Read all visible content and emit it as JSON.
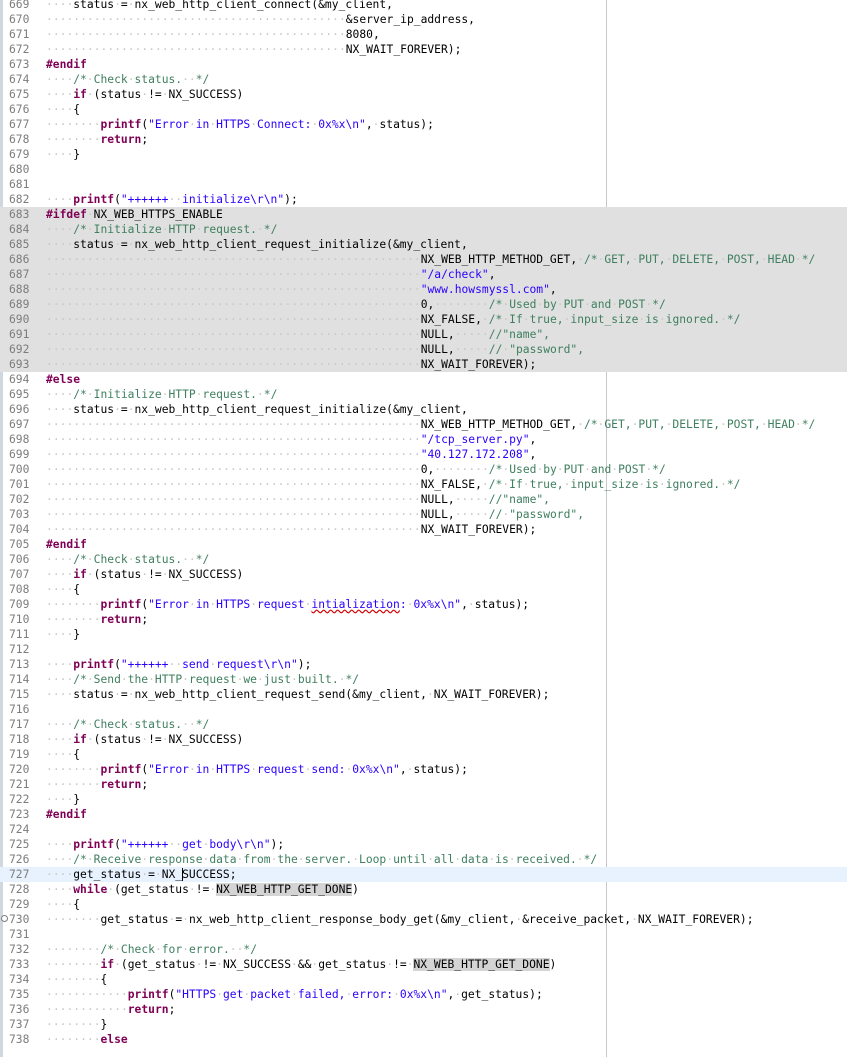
{
  "editor": {
    "lines": [
      {
        "n": "669",
        "t": "····status·=·nx_web_http_client_connect(&my_client,"
      },
      {
        "n": "670",
        "t": "············································&server_ip_address,"
      },
      {
        "n": "671",
        "t": "············································8080,"
      },
      {
        "n": "672",
        "t": "············································NX_WAIT_FOREVER);"
      },
      {
        "n": "673",
        "t": "#endif"
      },
      {
        "n": "674",
        "t": "····/*·Check·status.··*/"
      },
      {
        "n": "675",
        "t": "····if·(status·!=·NX_SUCCESS)"
      },
      {
        "n": "676",
        "t": "····{"
      },
      {
        "n": "677",
        "t": "········printf(\"Error·in·HTTPS·Connect:·0x%x\\n\",·status);"
      },
      {
        "n": "678",
        "t": "········return;"
      },
      {
        "n": "679",
        "t": "····}"
      },
      {
        "n": "680",
        "t": ""
      },
      {
        "n": "681",
        "t": ""
      },
      {
        "n": "682",
        "t": "····printf(\"++++++··initialize\\r\\n\");"
      },
      {
        "n": "683",
        "t": "#ifdef·NX_WEB_HTTPS_ENABLE",
        "shade": true
      },
      {
        "n": "684",
        "t": "····/*·Initialize·HTTP·request.·*/",
        "shade": true
      },
      {
        "n": "685",
        "t": "····status·=·nx_web_http_client_request_initialize(&my_client,",
        "shade": true
      },
      {
        "n": "686",
        "t": "·······················································NX_WEB_HTTP_METHOD_GET,·/*·GET,·PUT,·DELETE,·POST,·HEAD·*/",
        "shade": true
      },
      {
        "n": "687",
        "t": "·······················································\"/a/check\",",
        "shade": true
      },
      {
        "n": "688",
        "t": "·······················································\"www.howsmyssl.com\",",
        "shade": true
      },
      {
        "n": "689",
        "t": "·······················································0,········/*·Used·by·PUT·and·POST·*/",
        "shade": true
      },
      {
        "n": "690",
        "t": "·······················································NX_FALSE,·/*·If·true,·input_size·is·ignored.·*/",
        "shade": true
      },
      {
        "n": "691",
        "t": "·······················································NULL,·····//\"name\",",
        "shade": true
      },
      {
        "n": "692",
        "t": "·······················································NULL,·····//·\"password\",",
        "shade": true
      },
      {
        "n": "693",
        "t": "·······················································NX_WAIT_FOREVER);",
        "shade": true
      },
      {
        "n": "694",
        "t": "#else"
      },
      {
        "n": "695",
        "t": "····/*·Initialize·HTTP·request.·*/"
      },
      {
        "n": "696",
        "t": "····status·=·nx_web_http_client_request_initialize(&my_client,"
      },
      {
        "n": "697",
        "t": "·······················································NX_WEB_HTTP_METHOD_GET,·/*·GET,·PUT,·DELETE,·POST,·HEAD·*/"
      },
      {
        "n": "698",
        "t": "·······················································\"/tcp_server.py\","
      },
      {
        "n": "699",
        "t": "·······················································\"40.127.172.208\","
      },
      {
        "n": "700",
        "t": "·······················································0,········/*·Used·by·PUT·and·POST·*/"
      },
      {
        "n": "701",
        "t": "·······················································NX_FALSE,·/*·If·true,·input_size·is·ignored.·*/"
      },
      {
        "n": "702",
        "t": "·······················································NULL,·····//\"name\","
      },
      {
        "n": "703",
        "t": "·······················································NULL,·····//·\"password\","
      },
      {
        "n": "704",
        "t": "·······················································NX_WAIT_FOREVER);"
      },
      {
        "n": "705",
        "t": "#endif"
      },
      {
        "n": "706",
        "t": "····/*·Check·status.··*/"
      },
      {
        "n": "707",
        "t": "····if·(status·!=·NX_SUCCESS)"
      },
      {
        "n": "708",
        "t": "····{"
      },
      {
        "n": "709",
        "t": "········printf(\"Error·in·HTTPS·request·intialization:·0x%x\\n\",·status);"
      },
      {
        "n": "710",
        "t": "········return;"
      },
      {
        "n": "711",
        "t": "····}"
      },
      {
        "n": "712",
        "t": ""
      },
      {
        "n": "713",
        "t": "····printf(\"++++++··send·request\\r\\n\");"
      },
      {
        "n": "714",
        "t": "····/*·Send·the·HTTP·request·we·just·built.·*/"
      },
      {
        "n": "715",
        "t": "····status·=·nx_web_http_client_request_send(&my_client,·NX_WAIT_FOREVER);"
      },
      {
        "n": "716",
        "t": ""
      },
      {
        "n": "717",
        "t": "····/*·Check·status.··*/"
      },
      {
        "n": "718",
        "t": "····if·(status·!=·NX_SUCCESS)"
      },
      {
        "n": "719",
        "t": "····{"
      },
      {
        "n": "720",
        "t": "········printf(\"Error·in·HTTPS·request·send:·0x%x\\n\",·status);"
      },
      {
        "n": "721",
        "t": "········return;"
      },
      {
        "n": "722",
        "t": "····}"
      },
      {
        "n": "723",
        "t": "#endif"
      },
      {
        "n": "724",
        "t": ""
      },
      {
        "n": "725",
        "t": "····printf(\"++++++··get·body\\r\\n\");"
      },
      {
        "n": "726",
        "t": "····/*·Receive·response·data·from·the·server.·Loop·until·all·data·is·received.·*/"
      },
      {
        "n": "727",
        "t": "····get_status·=·NX_SUCCESS;",
        "cur": true
      },
      {
        "n": "728",
        "t": "····while·(get_status·!=·NX_WEB_HTTP_GET_DONE)"
      },
      {
        "n": "729",
        "t": "····{"
      },
      {
        "n": "730",
        "t": "········get_status·=·nx_web_http_client_response_body_get(&my_client,·&receive_packet,·NX_WAIT_FOREVER);",
        "fold": true
      },
      {
        "n": "731",
        "t": ""
      },
      {
        "n": "732",
        "t": "········/*·Check·for·error.··*/"
      },
      {
        "n": "733",
        "t": "········if·(get_status·!=·NX_SUCCESS·&&·get_status·!=·NX_WEB_HTTP_GET_DONE)"
      },
      {
        "n": "734",
        "t": "········{"
      },
      {
        "n": "735",
        "t": "············printf(\"HTTPS·get·packet·failed,·error:·0x%x\\n\",·get_status);"
      },
      {
        "n": "736",
        "t": "············return;"
      },
      {
        "n": "737",
        "t": "········}"
      },
      {
        "n": "738",
        "t": "········else"
      }
    ]
  },
  "colors": {
    "keyword": "#7f0055",
    "comment": "#3f7f5f",
    "string": "#2a00ff",
    "whitespace_marker": "#c7c7c7",
    "inactive_block": "#e0e0e0",
    "current_line": "#e8f2fe",
    "occurrence_highlight": "#d4d4d4"
  }
}
